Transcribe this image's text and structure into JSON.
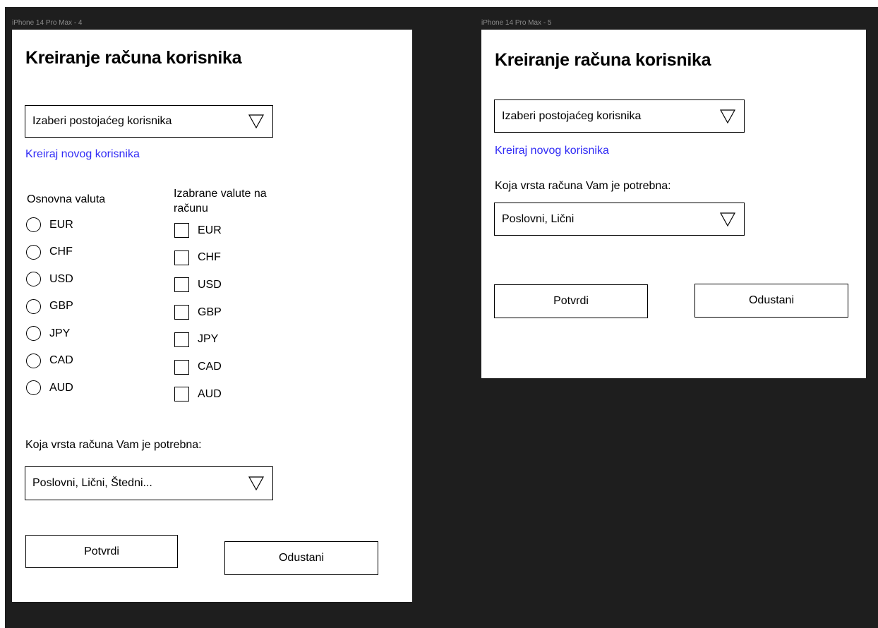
{
  "frames": [
    {
      "label": "iPhone 14 Pro Max - 4",
      "title": "Kreiranje računa korisnika",
      "user_select": "Izaberi postojaćeg korisnika",
      "create_link": "Kreiraj novog korisnika",
      "base_currency_label": "Osnovna valuta",
      "selected_currencies_label": "Izabrane valute na računu",
      "currencies": [
        "EUR",
        "CHF",
        "USD",
        "GBP",
        "JPY",
        "CAD",
        "AUD"
      ],
      "account_type_label": "Koja vrsta računa Vam  je potrebna:",
      "account_type_select": "Poslovni, Lični, Štedni...",
      "confirm_label": "Potvrdi",
      "cancel_label": "Odustani"
    },
    {
      "label": "iPhone 14 Pro Max - 5",
      "title": "Kreiranje računa korisnika",
      "user_select": "Izaberi postojaćeg korisnika",
      "create_link": "Kreiraj novog korisnika",
      "account_type_label": "Koja vrsta računa Vam  je potrebna:",
      "account_type_select": "Poslovni, Lični",
      "confirm_label": "Potvrdi",
      "cancel_label": "Odustani"
    }
  ],
  "colors": {
    "canvas": "#1e1e1e",
    "frame": "#ffffff",
    "link": "#2f2af5",
    "frame_label": "#8a8a8a"
  },
  "icons": {
    "dropdown": "triangle-down-outline-icon",
    "radio": "radio-empty-icon",
    "checkbox": "checkbox-empty-icon"
  }
}
